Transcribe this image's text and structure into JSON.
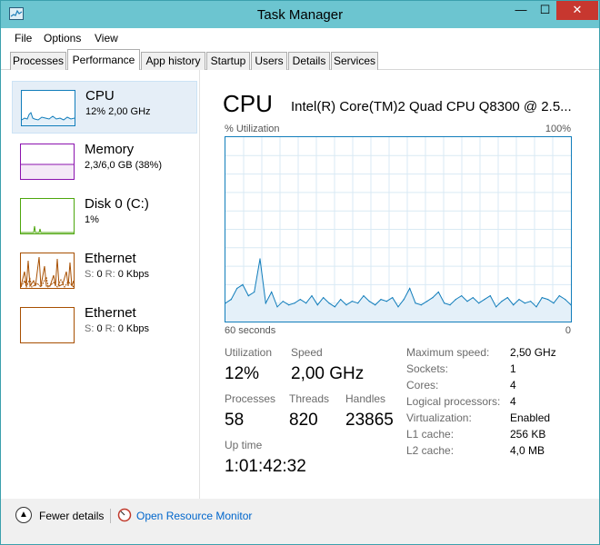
{
  "window": {
    "title": "Task Manager"
  },
  "controls": {
    "minimize": "—",
    "maximize": "☐",
    "close": "✕"
  },
  "menu": {
    "file": "File",
    "options": "Options",
    "view": "View"
  },
  "tabs": [
    {
      "label": "Processes"
    },
    {
      "label": "Performance"
    },
    {
      "label": "App history"
    },
    {
      "label": "Startup"
    },
    {
      "label": "Users"
    },
    {
      "label": "Details"
    },
    {
      "label": "Services"
    }
  ],
  "resources": [
    {
      "name": "CPU",
      "detail": "12% 2,00 GHz",
      "color": "#117dbb"
    },
    {
      "name": "Memory",
      "detail": "2,3/6,0 GB (38%)",
      "color": "#8b12ae"
    },
    {
      "name": "Disk 0 (C:)",
      "detail": "1%",
      "color": "#4da60c"
    },
    {
      "name": "Ethernet",
      "send_label": "S:",
      "send_value": "0",
      "recv_label": "R:",
      "recv_value": "0 Kbps",
      "color": "#a74f01"
    },
    {
      "name": "Ethernet",
      "send_label": "S:",
      "send_value": "0",
      "recv_label": "R:",
      "recv_value": "0 Kbps",
      "color": "#a74f01"
    }
  ],
  "cpu": {
    "title": "CPU",
    "model": "Intel(R) Core(TM)2 Quad CPU Q8300 @ 2.5...",
    "util_label": "% Utilization",
    "util_max": "100%",
    "time_left": "60 seconds",
    "time_right": "0",
    "stats": {
      "utilization_label": "Utilization",
      "utilization_value": "12%",
      "speed_label": "Speed",
      "speed_value": "2,00 GHz",
      "processes_label": "Processes",
      "processes_value": "58",
      "threads_label": "Threads",
      "threads_value": "820",
      "handles_label": "Handles",
      "handles_value": "23865",
      "uptime_label": "Up time",
      "uptime_value": "1:01:42:32"
    },
    "specs": [
      {
        "label": "Maximum speed:",
        "value": "2,50 GHz"
      },
      {
        "label": "Sockets:",
        "value": "1"
      },
      {
        "label": "Cores:",
        "value": "4"
      },
      {
        "label": "Logical processors:",
        "value": "4"
      },
      {
        "label": "Virtualization:",
        "value": "Enabled"
      },
      {
        "label": "L1 cache:",
        "value": "256 KB"
      },
      {
        "label": "L2 cache:",
        "value": "4,0 MB"
      }
    ]
  },
  "footer": {
    "fewer_details": "Fewer details",
    "resource_monitor": "Open Resource Monitor"
  },
  "chart_data": {
    "type": "area",
    "ylim": [
      0,
      100
    ],
    "grid": true,
    "x": [
      0,
      1,
      2,
      3,
      4,
      5,
      6,
      7,
      8,
      9,
      10,
      11,
      12,
      13,
      14,
      15,
      16,
      17,
      18,
      19,
      20,
      21,
      22,
      23,
      24,
      25,
      26,
      27,
      28,
      29,
      30,
      31,
      32,
      33,
      34,
      35,
      36,
      37,
      38,
      39,
      40,
      41,
      42,
      43,
      44,
      45,
      46,
      47,
      48,
      49,
      50,
      51,
      52,
      53,
      54,
      55,
      56,
      57,
      58,
      59,
      60
    ],
    "series": [
      {
        "values": [
          10,
          12,
          18,
          20,
          14,
          16,
          34,
          10,
          16,
          8,
          11,
          9,
          10,
          12,
          10,
          14,
          9,
          13,
          10,
          8,
          12,
          9,
          11,
          10,
          14,
          11,
          9,
          12,
          11,
          13,
          8,
          12,
          18,
          10,
          9,
          11,
          13,
          16,
          10,
          9,
          12,
          14,
          11,
          13,
          10,
          12,
          14,
          8,
          11,
          13,
          9,
          12,
          10,
          11,
          8,
          13,
          12,
          10,
          14,
          12,
          9
        ]
      }
    ]
  }
}
